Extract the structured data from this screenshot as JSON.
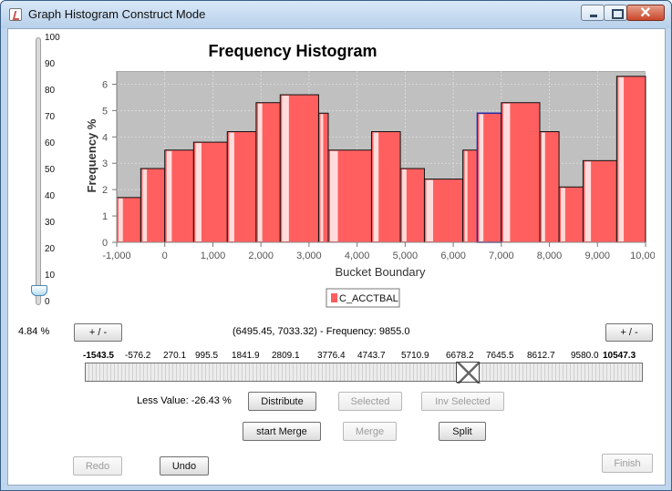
{
  "window": {
    "title": "Graph Histogram Construct Mode",
    "buttons": [
      "minimize",
      "maximize",
      "close"
    ]
  },
  "chart": {
    "title": "Frequency Histogram",
    "ylabel": "Frequency %",
    "xlabel": "Bucket Boundary",
    "legend": "C_ACCTBAL",
    "x_ticks": [
      "-1,000",
      "0",
      "1,000",
      "2,000",
      "3,000",
      "4,000",
      "5,000",
      "6,000",
      "7,000",
      "8,000",
      "9,000",
      "10,000"
    ],
    "y_ticks": [
      "0",
      "1",
      "2",
      "3",
      "4",
      "5",
      "6"
    ],
    "bars": [
      {
        "x0": -1000,
        "x1": -500,
        "value": 1.7
      },
      {
        "x0": -500,
        "x1": 0,
        "value": 2.8
      },
      {
        "x0": 0,
        "x1": 600,
        "value": 3.5
      },
      {
        "x0": 600,
        "x1": 1300,
        "value": 3.8
      },
      {
        "x0": 1300,
        "x1": 1900,
        "value": 4.2
      },
      {
        "x0": 1900,
        "x1": 2400,
        "value": 5.3
      },
      {
        "x0": 2400,
        "x1": 3200,
        "value": 5.6
      },
      {
        "x0": 3200,
        "x1": 3400,
        "value": 4.9
      },
      {
        "x0": 3400,
        "x1": 4300,
        "value": 3.5
      },
      {
        "x0": 4300,
        "x1": 4900,
        "value": 4.2
      },
      {
        "x0": 4900,
        "x1": 5400,
        "value": 2.8
      },
      {
        "x0": 5400,
        "x1": 6200,
        "value": 2.4
      },
      {
        "x0": 6200,
        "x1": 6500,
        "value": 3.5
      },
      {
        "x0": 6500,
        "x1": 7000,
        "value": 4.9
      },
      {
        "x0": 7000,
        "x1": 7800,
        "value": 5.3
      },
      {
        "x0": 7800,
        "x1": 8200,
        "value": 4.2
      },
      {
        "x0": 8200,
        "x1": 8700,
        "value": 2.1
      },
      {
        "x0": 8700,
        "x1": 9400,
        "value": 3.1
      },
      {
        "x0": 9400,
        "x1": 10000,
        "value": 6.3
      }
    ]
  },
  "slider": {
    "labels": [
      "100",
      "90",
      "80",
      "70",
      "60",
      "50",
      "40",
      "30",
      "20",
      "10",
      "0"
    ],
    "value": 4.84
  },
  "controls": {
    "percent": "4.84 %",
    "range_info": "(6495.45, 7033.32) - Frequency: 9855.0",
    "plus_minus_left": "+ / -",
    "plus_minus_right": "+ / -",
    "bucket_labels": [
      "-1543.5",
      "-576.2",
      "270.1",
      "995.5",
      "1841.9",
      "2809.1",
      "3776.4",
      "4743.7",
      "5710.9",
      "6678.2",
      "7645.5",
      "8612.7",
      "9580.0",
      "10547.3"
    ],
    "less_value": "Less Value: -26.43 %",
    "distribute": "Distribute",
    "selected": "Selected",
    "inv_selected": "Inv Selected",
    "start_merge": "start Merge",
    "merge": "Merge",
    "split": "Split",
    "redo": "Redo",
    "undo": "Undo",
    "finish": "Finish"
  },
  "colors": {
    "bar_fill": "#ff5f5f",
    "bar_dark": "#c44b4b",
    "plot_bg": "#c0c0c0",
    "selected_outline": "#2a2aa5"
  }
}
